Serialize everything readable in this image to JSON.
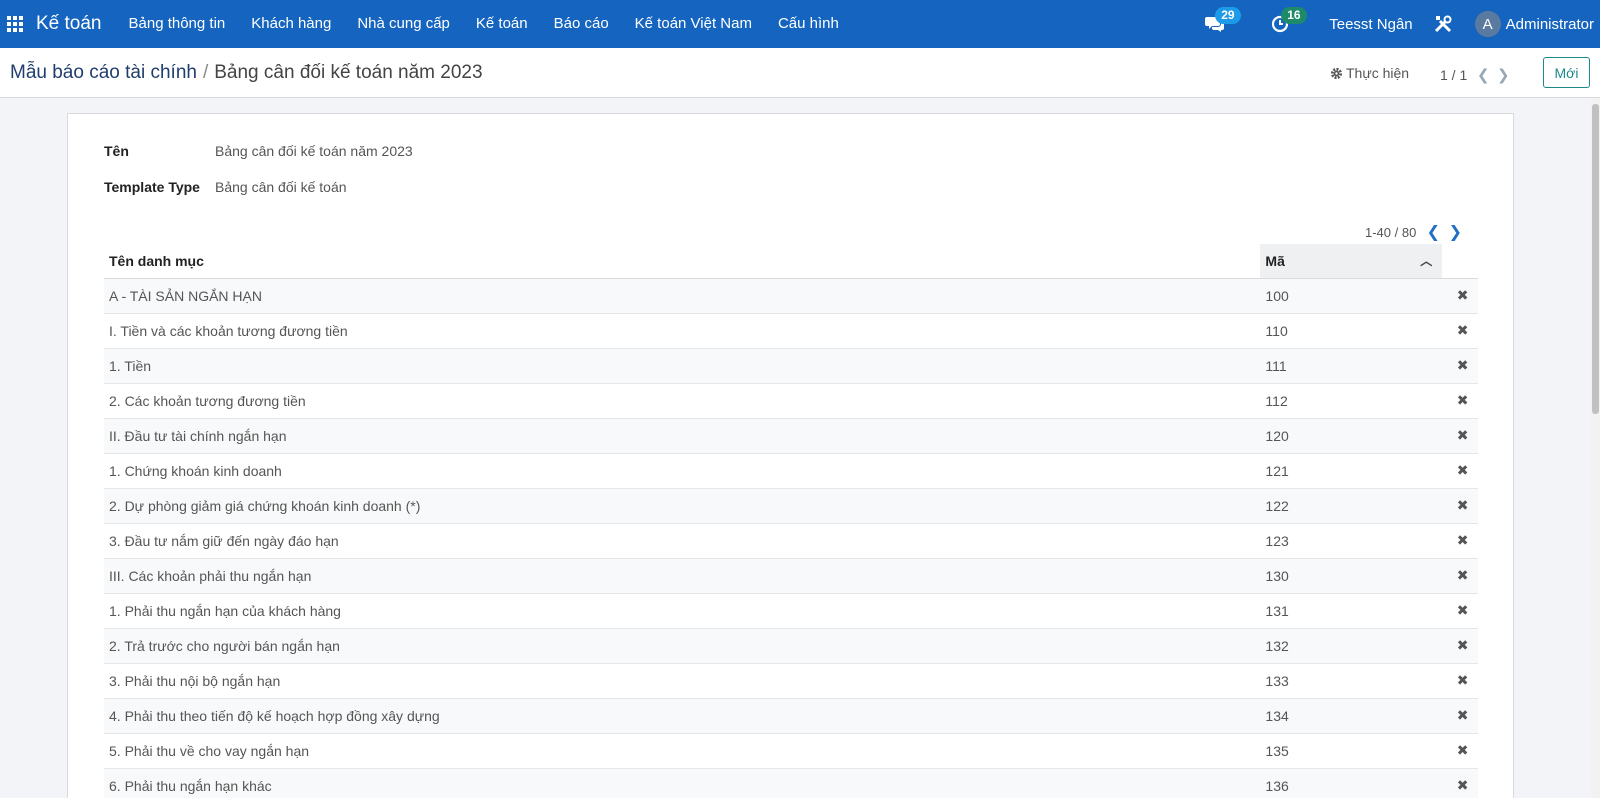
{
  "navbar": {
    "brand": "Kế toán",
    "menu": [
      "Bảng thông tin",
      "Khách hàng",
      "Nhà cung cấp",
      "Kế toán",
      "Báo cáo",
      "Kế toán Việt Nam",
      "Cấu hình"
    ],
    "messages_count": "29",
    "activities_count": "16",
    "company": "Teesst Ngân",
    "avatar_initial": "A",
    "user": "Administrator"
  },
  "breadcrumb": {
    "parent": "Mẫu báo cáo tài chính",
    "separator": "/",
    "current": "Bảng cân đối kế toán năm 2023"
  },
  "control": {
    "action": "Thực hiện",
    "pager": "1 / 1",
    "new_label": "Mới"
  },
  "form": {
    "name_label": "Tên",
    "name_value": "Bảng cân đối kế toán năm 2023",
    "type_label": "Template Type",
    "type_value": "Bảng cân đối kế toán"
  },
  "lines": {
    "pager": "1-40 / 80",
    "columns": {
      "name": "Tên danh mục",
      "code": "Mã"
    },
    "rows": [
      {
        "name": "A - TÀI SẢN NGẮN HẠN",
        "code": "100"
      },
      {
        "name": "I. Tiền và các khoản tương đương tiền",
        "code": "110"
      },
      {
        "name": "1. Tiền",
        "code": "111"
      },
      {
        "name": "2. Các khoản tương đương tiền",
        "code": "112"
      },
      {
        "name": "II. Đầu tư tài chính ngắn hạn",
        "code": "120"
      },
      {
        "name": "1. Chứng khoán kinh doanh",
        "code": "121"
      },
      {
        "name": "2. Dự phòng giảm giá chứng khoán kinh doanh (*)",
        "code": "122"
      },
      {
        "name": "3. Đầu tư nắm giữ đến ngày đáo hạn",
        "code": "123"
      },
      {
        "name": "III. Các khoản phải thu ngắn hạn",
        "code": "130"
      },
      {
        "name": "1. Phải thu ngắn hạn của khách hàng",
        "code": "131"
      },
      {
        "name": "2. Trả trước cho người bán ngắn hạn",
        "code": "132"
      },
      {
        "name": "3. Phải thu nội bộ ngắn hạn",
        "code": "133"
      },
      {
        "name": "4. Phải thu theo tiến độ kế hoạch hợp đồng xây dựng",
        "code": "134"
      },
      {
        "name": "5. Phải thu về cho vay ngắn hạn",
        "code": "135"
      },
      {
        "name": "6. Phải thu ngắn hạn khác",
        "code": "136"
      }
    ]
  },
  "icons": {
    "apps": "apps-icon",
    "chat": "chat-icon",
    "clock": "clock-icon",
    "tools": "tools-icon",
    "gear": "gear-icon",
    "delete": "delete-icon",
    "sort": "sort-up-icon"
  }
}
